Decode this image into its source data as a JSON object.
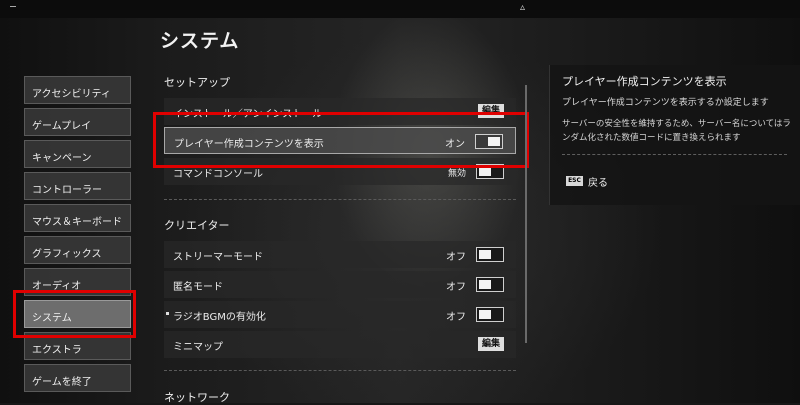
{
  "page_title": "システム",
  "top_icon": "▵",
  "sidebar": {
    "items": [
      {
        "label": "アクセシビリティ"
      },
      {
        "label": "ゲームプレイ"
      },
      {
        "label": "キャンペーン"
      },
      {
        "label": "コントローラー"
      },
      {
        "label": "マウス＆キーボード"
      },
      {
        "label": "グラフィックス"
      },
      {
        "label": "オーディオ"
      },
      {
        "label": "システム",
        "active": true
      },
      {
        "label": "エクストラ"
      },
      {
        "label": "ゲームを終了"
      }
    ]
  },
  "sections": {
    "setup": {
      "header": "セットアップ",
      "rows": [
        {
          "label": "インストール／アンインストール",
          "edit": "編集"
        },
        {
          "label": "プレイヤー作成コンテンツを表示",
          "value": "オン",
          "toggle": "on"
        },
        {
          "label": "コマンドコンソール",
          "value": "無効",
          "toggle": "off"
        }
      ]
    },
    "creator": {
      "header": "クリエイター",
      "rows": [
        {
          "label": "ストリーマーモード",
          "value": "オフ",
          "toggle": "off"
        },
        {
          "label": "匿名モード",
          "value": "オフ",
          "toggle": "off"
        },
        {
          "label": "ラジオBGMの有効化",
          "value": "オフ",
          "toggle": "off"
        },
        {
          "label": "ミニマップ",
          "edit": "編集"
        }
      ]
    },
    "network": {
      "header": "ネットワーク"
    }
  },
  "info_panel": {
    "title": "プレイヤー作成コンテンツを表示",
    "subtitle": "プレイヤー作成コンテンツを表示するか設定します",
    "description": "サーバーの安全性を維持するため、サーバー名についてはランダム化された数値コードに置き換えられます",
    "esc_key": "ESC",
    "back_label": "戻る"
  }
}
